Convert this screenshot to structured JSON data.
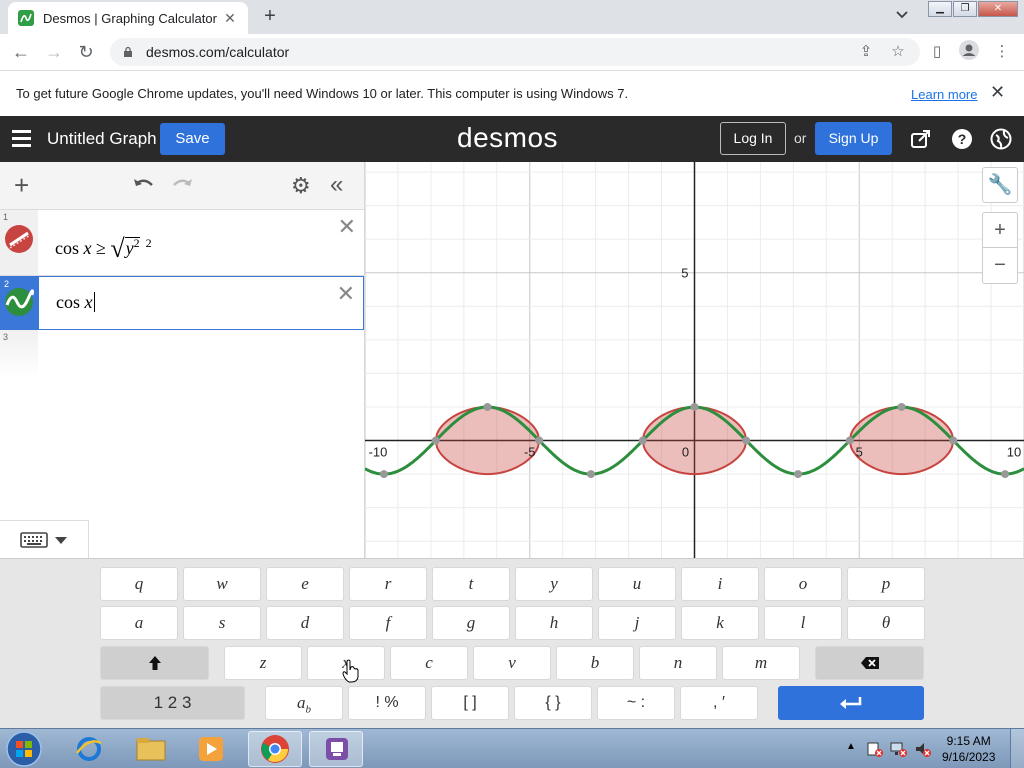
{
  "browser": {
    "tab_title": "Desmos | Graphing Calculator",
    "tab_close": "✕",
    "new_tab": "+",
    "url": "desmos.com/calculator",
    "infobar_message": "To get future Google Chrome updates, you'll need Windows 10 or later. This computer is using Windows 7.",
    "infobar_link": "Learn more",
    "infobar_close": "✕"
  },
  "header": {
    "graph_title": "Untitled Graph",
    "save_label": "Save",
    "logo": "desmos",
    "login_label": "Log In",
    "or_text": "or",
    "signup_label": "Sign Up"
  },
  "expressions": [
    {
      "number": "1",
      "type": "inequality",
      "color": "#c74440",
      "text": "cos x ≥ √y² 2"
    },
    {
      "number": "2",
      "type": "function",
      "color": "#2d8e3e",
      "text": "cos x",
      "active": true
    },
    {
      "number": "3",
      "text": ""
    }
  ],
  "graph": {
    "x_ticks": [
      "-10",
      "-5",
      "0",
      "5",
      "10"
    ],
    "y_ticks": [
      "5"
    ],
    "xlim": [
      -10,
      10
    ],
    "ylim": [
      -3.5,
      8.3
    ],
    "curve_color": "#2d8e3e",
    "region_color": "#c74440"
  },
  "keyboard": {
    "row1": [
      "q",
      "w",
      "e",
      "r",
      "t",
      "y",
      "u",
      "i",
      "o",
      "p"
    ],
    "row2": [
      "a",
      "s",
      "d",
      "f",
      "g",
      "h",
      "j",
      "k",
      "l",
      "θ"
    ],
    "row3": [
      "z",
      "x",
      "c",
      "v",
      "b",
      "n",
      "m"
    ],
    "numbers_label": "1 2 3",
    "subscript_label": "a",
    "subscript_sub": "b",
    "punct1": "! %",
    "brackets": "[ ]",
    "braces": "{ }",
    "tilde": "~ :",
    "comma": ", ′"
  },
  "taskbar": {
    "time": "9:15 AM",
    "date": "9/16/2023"
  }
}
